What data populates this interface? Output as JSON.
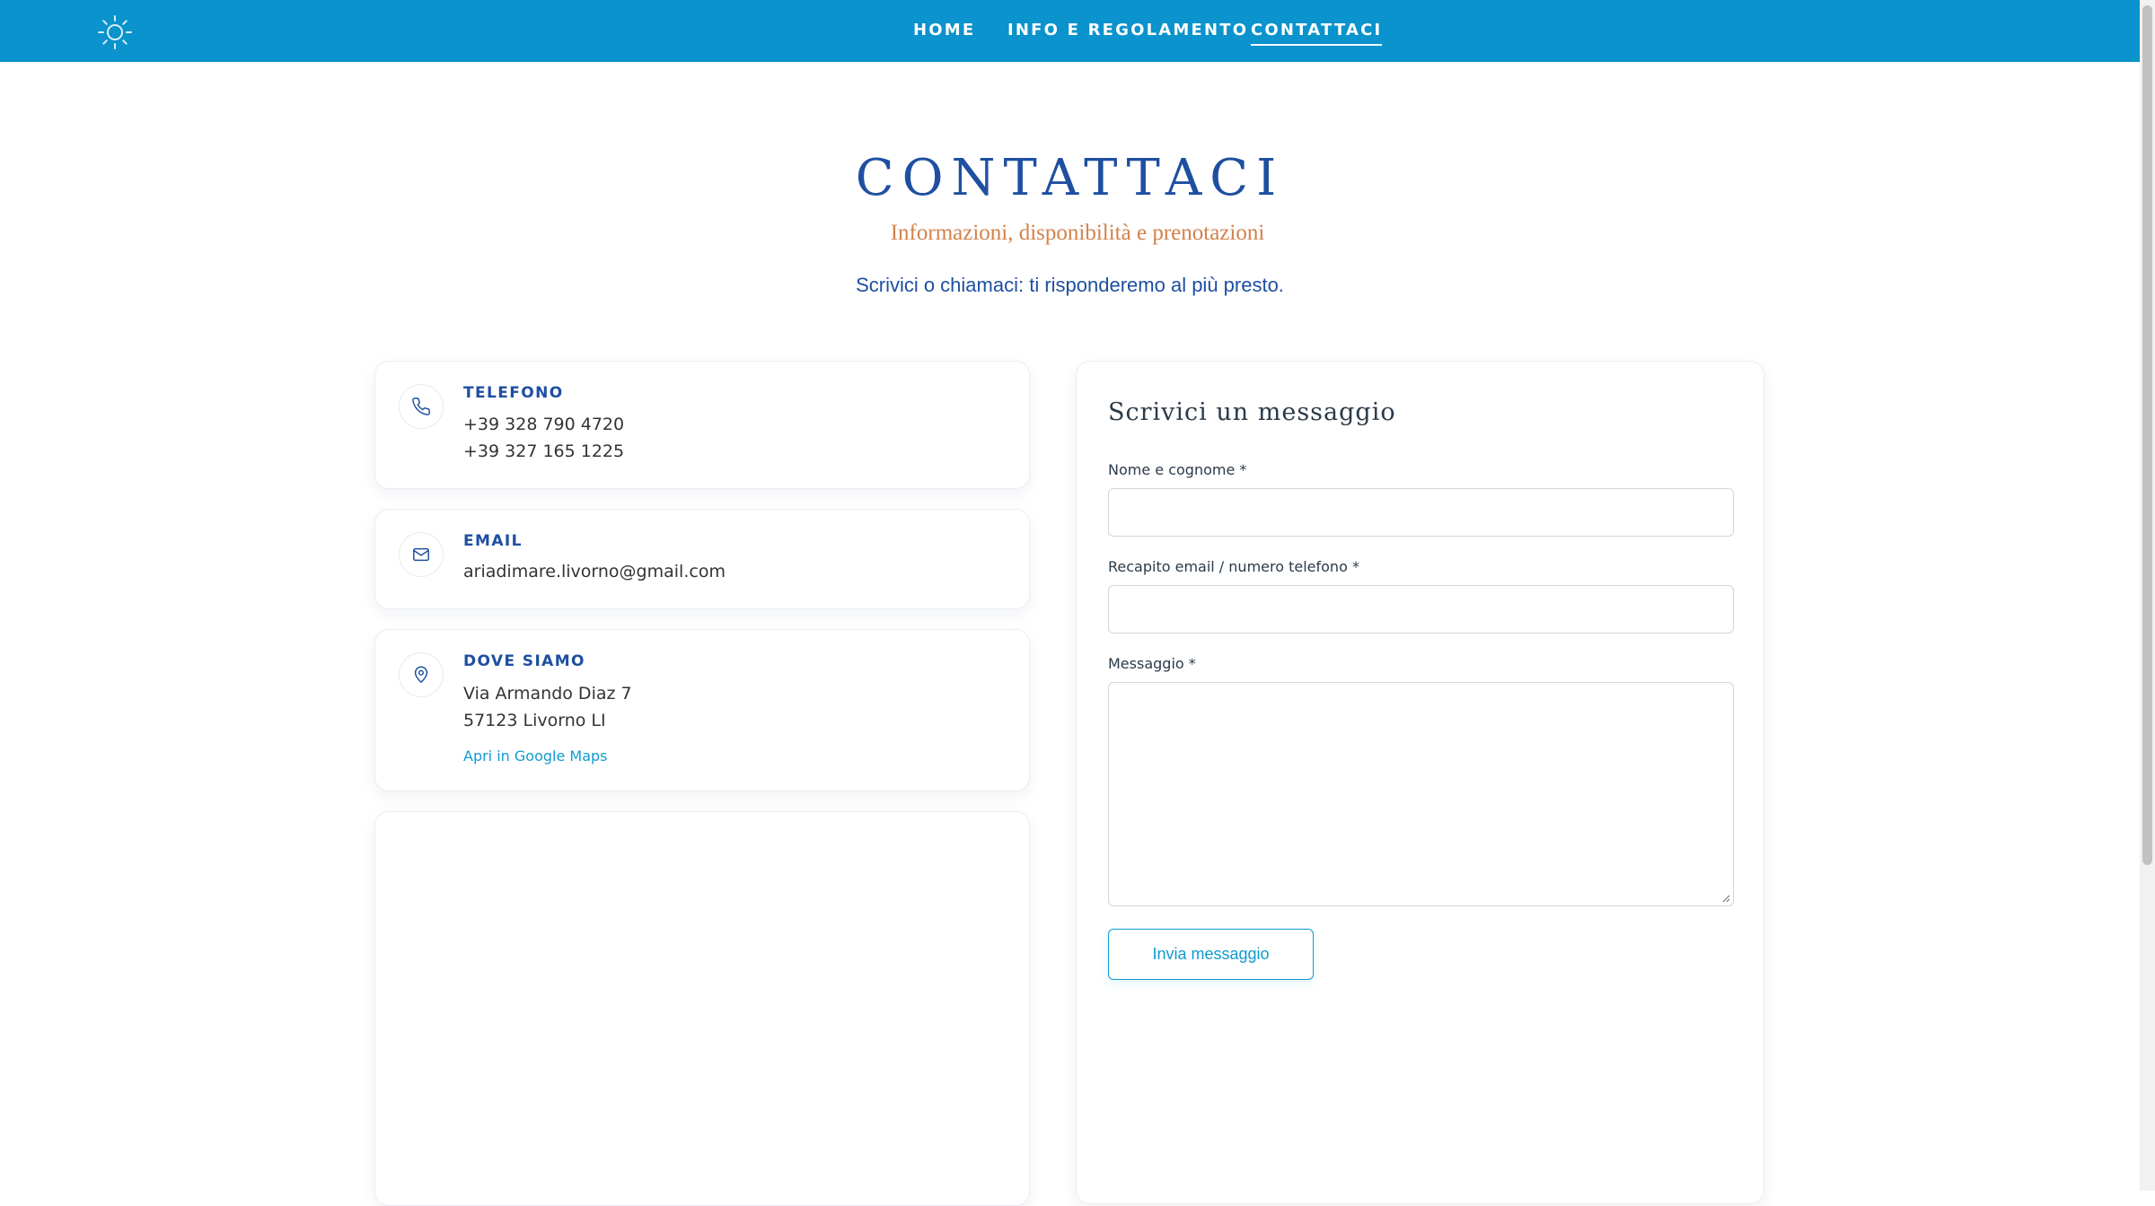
{
  "nav": {
    "items": [
      {
        "label": "HOME"
      },
      {
        "label": "INFO E REGOLAMENTO"
      },
      {
        "label": "CONTATTACI",
        "active": true
      }
    ]
  },
  "header": {
    "title": "CONTATTACI",
    "subtitle": "Informazioni, disponibilità e prenotazioni",
    "lead": "Scrivici o chiamaci: ti risponderemo al più presto."
  },
  "contacts": {
    "phone": {
      "label": "TELEFONO",
      "icon": "phone-icon",
      "lines": [
        "+39 328 790 4720",
        "+39 327 165 1225"
      ]
    },
    "email": {
      "label": "EMAIL",
      "icon": "mail-icon",
      "value": "ariadimare.livorno@gmail.com"
    },
    "location": {
      "label": "DOVE SIAMO",
      "icon": "location-pin-icon",
      "lines": [
        "Via Armando Diaz 7",
        "57123 Livorno LI"
      ],
      "link_label": "Apri in Google Maps"
    }
  },
  "form": {
    "title": "Scrivici un messaggio",
    "fields": [
      {
        "label": "Nome e cognome *",
        "value": ""
      },
      {
        "label": "Recapito email / numero telefono *",
        "value": ""
      },
      {
        "label": "Messaggio *",
        "value": ""
      }
    ],
    "submit_label": "Invia messaggio"
  },
  "colors": {
    "topbar": "#0a93cc",
    "primary_text": "#1e4fa1",
    "accent_orange": "#d4814a",
    "link": "#0f9ccf"
  },
  "logo": {
    "icon": "sun-icon"
  }
}
